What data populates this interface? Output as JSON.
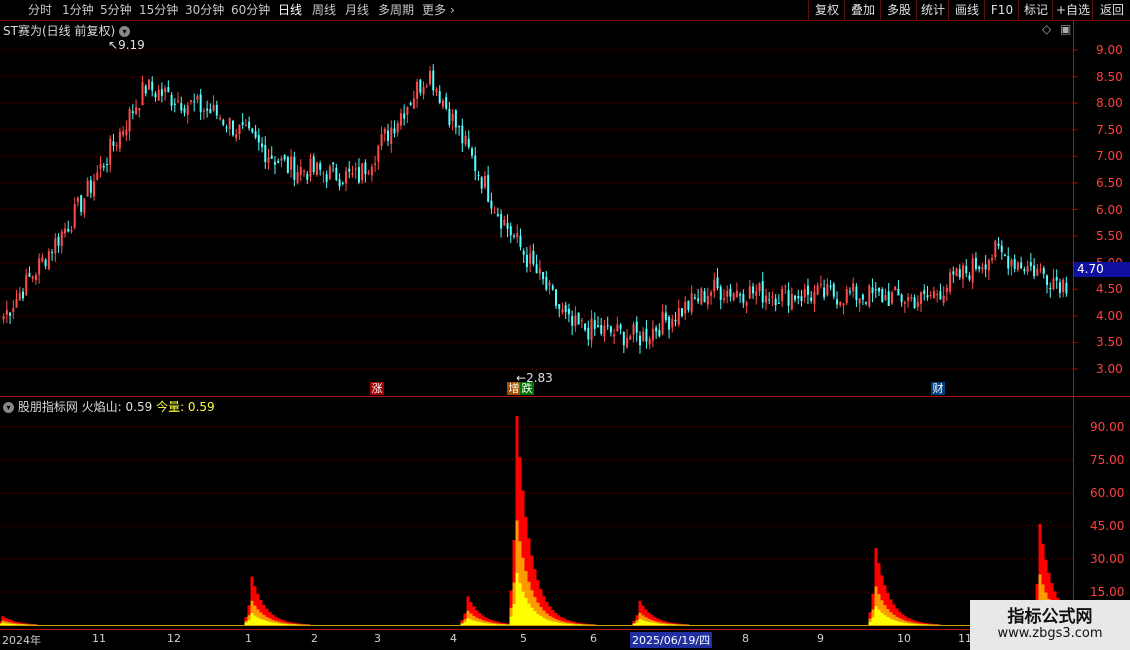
{
  "toolbar": {
    "periods": [
      "分时",
      "1分钟",
      "5分钟",
      "15分钟",
      "30分钟",
      "60分钟",
      "日线",
      "周线",
      "月线",
      "多周期",
      "更多"
    ],
    "active_period": "日线",
    "buttons": [
      "复权",
      "叠加",
      "多股",
      "统计",
      "画线",
      "F10",
      "标记",
      "+自选",
      "返回"
    ]
  },
  "main_panel": {
    "title": "ST赛为(日线 前复权)",
    "price_axis": [
      "9.00",
      "8.50",
      "8.00",
      "7.50",
      "7.00",
      "6.50",
      "6.00",
      "5.50",
      "5.00",
      "4.50",
      "4.00",
      "3.50",
      "3.00"
    ],
    "current_price": "4.70",
    "high_label": "9.19",
    "low_label": "2.83",
    "markers": [
      "涨",
      "增",
      "跌",
      "财"
    ]
  },
  "sub_panel": {
    "title_prefix": "股朋指标网",
    "indicator_label": "火焰山: 0.59",
    "today_label": "今量: 0.59",
    "axis": [
      "90.00",
      "75.00",
      "60.00",
      "45.00",
      "30.00",
      "15.00"
    ]
  },
  "x_axis": {
    "labels": [
      "2024年",
      "11",
      "12",
      "1",
      "2",
      "3",
      "4",
      "5",
      "6",
      "2025/06/19/四",
      "8",
      "9",
      "10",
      "11"
    ]
  },
  "watermark": {
    "line1": "指标公式网",
    "line2": "www.zbgs3.com"
  },
  "colors": {
    "up": "#ff4d4d",
    "down": "#54ffff",
    "flame_red": "#ff0000",
    "flame_yellow": "#ffff00",
    "grid": "#6e0000"
  },
  "chart_data": [
    {
      "type": "candlestick",
      "title": "ST赛为(日线 前复权)",
      "ylim": [
        2.7,
        9.5
      ],
      "anchor_points": [
        {
          "x": "2024-09",
          "y": 4.0
        },
        {
          "x": "2024-10",
          "y": 5.9
        },
        {
          "x": "2024-11",
          "y": 8.3
        },
        {
          "x": "2024-12",
          "y": 7.8
        },
        {
          "x": "2025-01",
          "y": 6.8
        },
        {
          "x": "2025-02",
          "y": 6.6
        },
        {
          "x": "2025-03",
          "y": 8.6
        },
        {
          "x": "2025-04",
          "y": 5.9
        },
        {
          "x": "2025-05",
          "y": 3.8
        },
        {
          "x": "2025-06",
          "y": 3.6
        },
        {
          "x": "2025-07",
          "y": 4.5
        },
        {
          "x": "2025-08",
          "y": 4.4
        },
        {
          "x": "2025-09",
          "y": 4.4
        },
        {
          "x": "2025-10",
          "y": 4.3
        },
        {
          "x": "2025-11",
          "y": 5.2
        },
        {
          "x": "2025-12",
          "y": 4.6
        }
      ],
      "high": 9.19,
      "low": 2.83,
      "last": 4.7
    },
    {
      "type": "bar",
      "title": "火焰山",
      "ylim": [
        0,
        100
      ],
      "peaks": [
        {
          "x": "2024-09",
          "value": 4
        },
        {
          "x": "2025-01",
          "value": 22
        },
        {
          "x": "2025-04",
          "value": 13
        },
        {
          "x": "2025-05",
          "value": 95
        },
        {
          "x": "2025-06",
          "value": 11
        },
        {
          "x": "2025-09",
          "value": 35
        },
        {
          "x": "2025-12",
          "value": 46
        }
      ],
      "last": 0.59
    }
  ]
}
